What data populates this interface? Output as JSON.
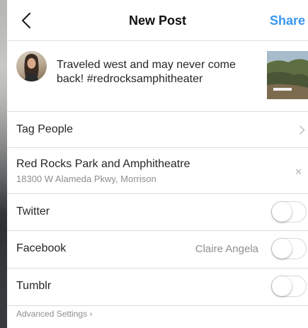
{
  "header": {
    "title": "New Post",
    "share_label": "Share"
  },
  "compose": {
    "caption": "Traveled west and may never come back! #redrocksamphitheater"
  },
  "rows": {
    "tag_people": "Tag People",
    "location_name": "Red Rocks Park and Amphitheatre",
    "location_address": "18300 W Alameda Pkwy, Morrison",
    "twitter": "Twitter",
    "facebook": "Facebook",
    "facebook_account": "Claire Angela",
    "tumblr": "Tumblr"
  },
  "advanced_settings": "Advanced Settings ›",
  "toggles": {
    "twitter_on": false,
    "facebook_on": false,
    "tumblr_on": false
  },
  "colors": {
    "accent": "#3897f0",
    "text": "#262626",
    "muted": "#8e8e8e"
  },
  "icons": [
    "back-chevron-icon",
    "chevron-right-icon",
    "close-icon"
  ]
}
